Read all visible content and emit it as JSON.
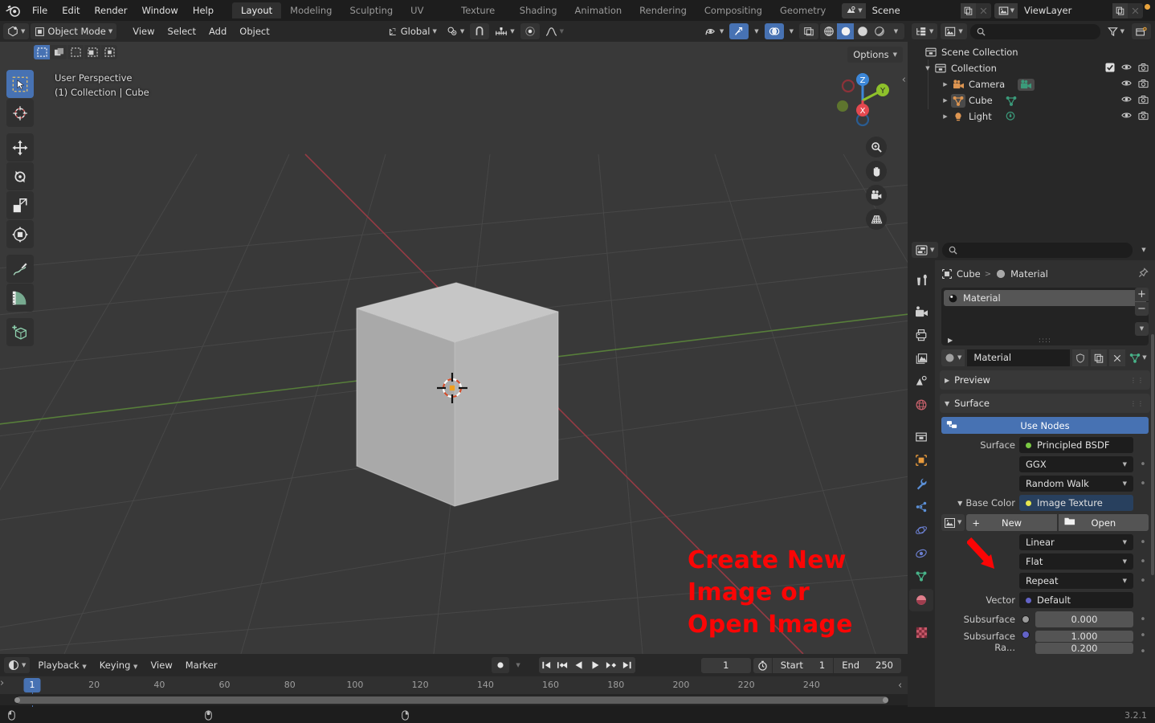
{
  "app": {
    "version": "3.2.1"
  },
  "topbar": {
    "logo_icon": "blender-logo-icon",
    "menus": [
      "File",
      "Edit",
      "Render",
      "Window",
      "Help"
    ],
    "workspaces": [
      {
        "label": "Layout",
        "active": true
      },
      {
        "label": "Modeling",
        "active": false
      },
      {
        "label": "Sculpting",
        "active": false
      },
      {
        "label": "UV Editing",
        "active": false
      },
      {
        "label": "Texture Paint",
        "active": false
      },
      {
        "label": "Shading",
        "active": false
      },
      {
        "label": "Animation",
        "active": false
      },
      {
        "label": "Rendering",
        "active": false
      },
      {
        "label": "Compositing",
        "active": false
      },
      {
        "label": "Geometry Nodes",
        "active": false
      }
    ],
    "scene": {
      "icon": "scene-icon",
      "name": "Scene",
      "copy_icon": "duplicate-icon",
      "unlink_icon": "x-icon"
    },
    "viewlayer": {
      "icon": "viewlayer-icon",
      "name": "ViewLayer",
      "copy_icon": "duplicate-icon",
      "unlink_icon": "x-icon"
    }
  },
  "viewport_header": {
    "editor_type_icon": "editor-type-3dview-icon",
    "mode": "Object Mode",
    "mode_icon": "object-mode-icon",
    "menus": [
      "View",
      "Select",
      "Add",
      "Object"
    ],
    "transform_orientation": {
      "icon": "orientation-icon",
      "label": "Global"
    },
    "pivot_icon": "pivot-point-icon",
    "snap_icon": "magnet-icon",
    "snap_target_icon": "snap-increment-icon",
    "proportional_icon": "proportional-edit-icon",
    "falloff_icon": "falloff-curve-icon",
    "visibility_icon": "show-hide-icon",
    "gizmo_icon": "gizmo-icon",
    "overlays_icon": "overlays-icon",
    "xray_icon": "xray-icon",
    "shading_modes": [
      {
        "icon": "wireframe-icon",
        "active": false
      },
      {
        "icon": "solid-shading-icon",
        "active": true
      },
      {
        "icon": "material-preview-icon",
        "active": false
      },
      {
        "icon": "rendered-shading-icon",
        "active": false
      }
    ],
    "options_label": "Options"
  },
  "viewport": {
    "select_modes": [
      {
        "icon": "select-box-icon",
        "active": true
      },
      {
        "icon": "select-extend-icon",
        "active": false
      },
      {
        "icon": "select-subtract-icon",
        "active": false
      },
      {
        "icon": "select-invert-icon",
        "active": false
      },
      {
        "icon": "select-intersect-icon",
        "active": false
      }
    ],
    "info_line1": "User Perspective",
    "info_line2": "(1) Collection | Cube",
    "tools": [
      {
        "name": "tweak-select-box-tool",
        "icon": "cursor-box-select-icon",
        "active": true
      },
      {
        "name": "cursor-tool",
        "icon": "3d-cursor-icon",
        "active": false
      },
      {
        "name": "move-tool",
        "icon": "move-arrows-icon",
        "active": false
      },
      {
        "name": "rotate-tool",
        "icon": "rotate-icon",
        "active": false
      },
      {
        "name": "scale-tool",
        "icon": "scale-icon",
        "active": false
      },
      {
        "name": "transform-tool",
        "icon": "transform-icon",
        "active": false
      },
      {
        "name": "annotate-tool",
        "icon": "pencil-icon",
        "active": false
      },
      {
        "name": "measure-tool",
        "icon": "ruler-icon",
        "active": false
      },
      {
        "name": "add-cube-tool",
        "icon": "add-cube-icon",
        "active": false
      }
    ],
    "gizmo_axes": [
      {
        "label": "Z",
        "color": "#3c87d8"
      },
      {
        "label": "Y",
        "color": "#8ec12b"
      },
      {
        "label": "X",
        "color": "#e4484f"
      }
    ],
    "nav_buttons": [
      {
        "name": "zoom-view-button",
        "icon": "zoom-icon"
      },
      {
        "name": "pan-view-button",
        "icon": "hand-icon"
      },
      {
        "name": "camera-view-button",
        "icon": "camera-icon"
      },
      {
        "name": "toggle-perspective-button",
        "icon": "perspective-grid-icon"
      }
    ],
    "annotation_text": "Create New Image or\nOpen Image",
    "annotation_color": "#fb0505"
  },
  "timeline": {
    "editor_icon": "timeline-editor-icon",
    "menus": [
      "Playback",
      "Keying",
      "View",
      "Marker"
    ],
    "record_icon": "record-icon",
    "transport": [
      {
        "name": "jump-to-start-button",
        "icon": "jump-start-icon"
      },
      {
        "name": "previous-keyframe-button",
        "icon": "prev-keyframe-icon"
      },
      {
        "name": "play-reverse-button",
        "icon": "play-reverse-icon"
      },
      {
        "name": "play-button",
        "icon": "play-icon"
      },
      {
        "name": "next-keyframe-button",
        "icon": "next-keyframe-icon"
      },
      {
        "name": "jump-to-end-button",
        "icon": "jump-end-icon"
      }
    ],
    "current_frame": "1",
    "timer_icon": "stopwatch-icon",
    "start_label": "Start",
    "start_value": "1",
    "end_label": "End",
    "end_value": "250",
    "ticks": [
      "20",
      "40",
      "60",
      "80",
      "100",
      "120",
      "140",
      "160",
      "180",
      "200",
      "220",
      "240"
    ],
    "playhead_label": "1"
  },
  "outliner": {
    "display_mode_icon": "outliner-display-mode-icon",
    "filter_type_icon": "viewlayer-icon",
    "search_icon": "search-icon",
    "search_value": "",
    "filter_icon": "funnel-icon",
    "new_collection_icon": "new-collection-icon",
    "rows": [
      {
        "label": "Scene Collection",
        "icon": "scene-collection-icon",
        "indent": 0,
        "expandable": false,
        "checkbox": false,
        "eye": false,
        "camera": false
      },
      {
        "label": "Collection",
        "icon": "collection-icon",
        "indent": 1,
        "expandable": true,
        "expanded": true,
        "checkbox": true,
        "eye": true,
        "camera": true
      },
      {
        "label": "Camera",
        "icon": "camera-object-icon",
        "data_icon": "camera-data-icon",
        "indent": 2,
        "expandable": true,
        "expanded": false,
        "checkbox": false,
        "eye": true,
        "camera": true
      },
      {
        "label": "Cube",
        "icon": "mesh-object-icon",
        "data_icon": "mesh-data-icon",
        "indent": 2,
        "expandable": true,
        "expanded": false,
        "checkbox": false,
        "eye": true,
        "camera": true,
        "selected": true
      },
      {
        "label": "Light",
        "icon": "light-object-icon",
        "data_icon": "light-data-icon",
        "indent": 2,
        "expandable": true,
        "expanded": false,
        "checkbox": false,
        "eye": true,
        "camera": true
      }
    ]
  },
  "properties": {
    "editor_icon": "properties-editor-icon",
    "search_icon": "search-icon",
    "search_value": "",
    "expand_icon": "chevron-down-icon",
    "tabs": [
      {
        "name": "tool-tab",
        "icon": "tool-icon",
        "active": false
      },
      {
        "name": "render-tab",
        "icon": "render-camera-icon",
        "active": false
      },
      {
        "name": "output-tab",
        "icon": "printer-icon",
        "active": false
      },
      {
        "name": "viewlayer-tab",
        "icon": "images-icon",
        "active": false
      },
      {
        "name": "scene-tab",
        "icon": "scene-cone-icon",
        "active": false
      },
      {
        "name": "world-tab",
        "icon": "world-globe-icon",
        "active": false
      },
      {
        "name": "collection-tab",
        "icon": "collection-box-icon",
        "active": false
      },
      {
        "name": "object-tab",
        "icon": "object-square-icon",
        "active": false
      },
      {
        "name": "modifiers-tab",
        "icon": "wrench-icon",
        "active": false
      },
      {
        "name": "particles-tab",
        "icon": "particles-icon",
        "active": false
      },
      {
        "name": "physics-tab",
        "icon": "physics-orbit-icon",
        "active": false
      },
      {
        "name": "constraints-tab",
        "icon": "constraint-icon",
        "active": false
      },
      {
        "name": "data-tab",
        "icon": "mesh-data-triangle-icon",
        "active": false
      },
      {
        "name": "material-tab",
        "icon": "material-sphere-icon",
        "active": true
      },
      {
        "name": "texture-tab",
        "icon": "texture-checker-icon",
        "active": false
      }
    ],
    "breadcrumb": {
      "object_icon": "object-square-icon",
      "object": "Cube",
      "separator": ">",
      "material_icon": "material-sphere-icon",
      "material": "Material",
      "pin_icon": "pin-icon"
    },
    "material_slots": {
      "items": [
        {
          "label": "Material",
          "icon": "material-sphere-icon",
          "selected": true
        }
      ],
      "add_icon": "plus-icon",
      "remove_icon": "minus-icon",
      "menu_icon": "chevron-down-icon",
      "specials_grip": "::::",
      "expand_tri": "triangle-right-icon"
    },
    "material_id": {
      "browse_icon": "material-sphere-icon",
      "name": "Material",
      "fake_user_icon": "shield-icon",
      "copy_icon": "duplicate-icon",
      "unlink_icon": "x-icon",
      "link_icon": "object-data-link-icon"
    },
    "panels": [
      {
        "name": "preview-panel",
        "label": "Preview",
        "open": false
      },
      {
        "name": "surface-panel",
        "label": "Surface",
        "open": true
      }
    ],
    "use_nodes": {
      "label": "Use Nodes",
      "icon": "nodetree-icon",
      "color": "#4772b3"
    },
    "surface": {
      "label": "Surface",
      "value": "Principled BSDF",
      "socket_color": "#7ac943"
    },
    "distribution": {
      "value": "GGX"
    },
    "subsurface_method": {
      "value": "Random Walk"
    },
    "base_color": {
      "label": "Base Color",
      "value": "Image Texture",
      "socket_color": "#e5e54f",
      "linked": true
    },
    "image_block": {
      "browse_icon": "image-browse-icon",
      "new_icon": "plus-icon",
      "new_label": "New",
      "open_icon": "folder-icon",
      "open_label": "Open"
    },
    "interpolation": {
      "value": "Linear"
    },
    "projection": {
      "value": "Flat"
    },
    "extension": {
      "value": "Repeat"
    },
    "vector": {
      "label": "Vector",
      "value": "Default",
      "socket_color": "#6363c7"
    },
    "subsurface": {
      "label": "Subsurface",
      "value": "0.000",
      "socket_color": "#9a9a9a"
    },
    "subsurface_radius": {
      "label": "Subsurface Ra...",
      "value_1": "1.000",
      "value_2": "0.200",
      "socket_color": "#6363c7"
    }
  },
  "statusbar": {
    "mouse_hints": [
      {
        "icon": "mouse-left-icon"
      },
      {
        "icon": "mouse-middle-icon"
      },
      {
        "icon": "mouse-right-icon"
      }
    ],
    "version": "3.2.1"
  }
}
